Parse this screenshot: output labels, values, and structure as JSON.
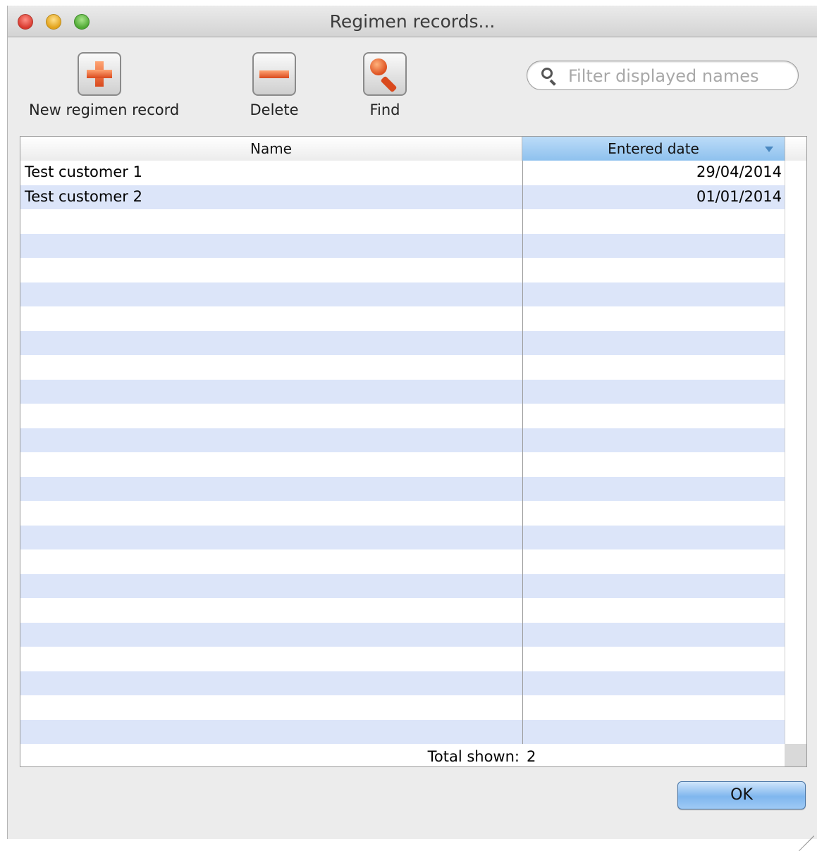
{
  "window": {
    "title": "Regimen records..."
  },
  "toolbar": {
    "new_label": "New regimen record",
    "delete_label": "Delete",
    "find_label": "Find"
  },
  "search": {
    "placeholder": "Filter displayed names"
  },
  "table": {
    "columns": [
      "Name",
      "Entered date"
    ],
    "sorted_column": "Entered date",
    "rows": [
      {
        "name": "Test customer 1",
        "entered_date": "29/04/2014"
      },
      {
        "name": "Test customer 2",
        "entered_date": "01/01/2014"
      }
    ],
    "total_label": "Total shown:",
    "total_value": "2"
  },
  "actions": {
    "ok_label": "OK"
  },
  "colors": {
    "row_stripe": "#dce5f9",
    "header_selected": "#8ec1ee",
    "accent_icon": "#e1582a"
  }
}
